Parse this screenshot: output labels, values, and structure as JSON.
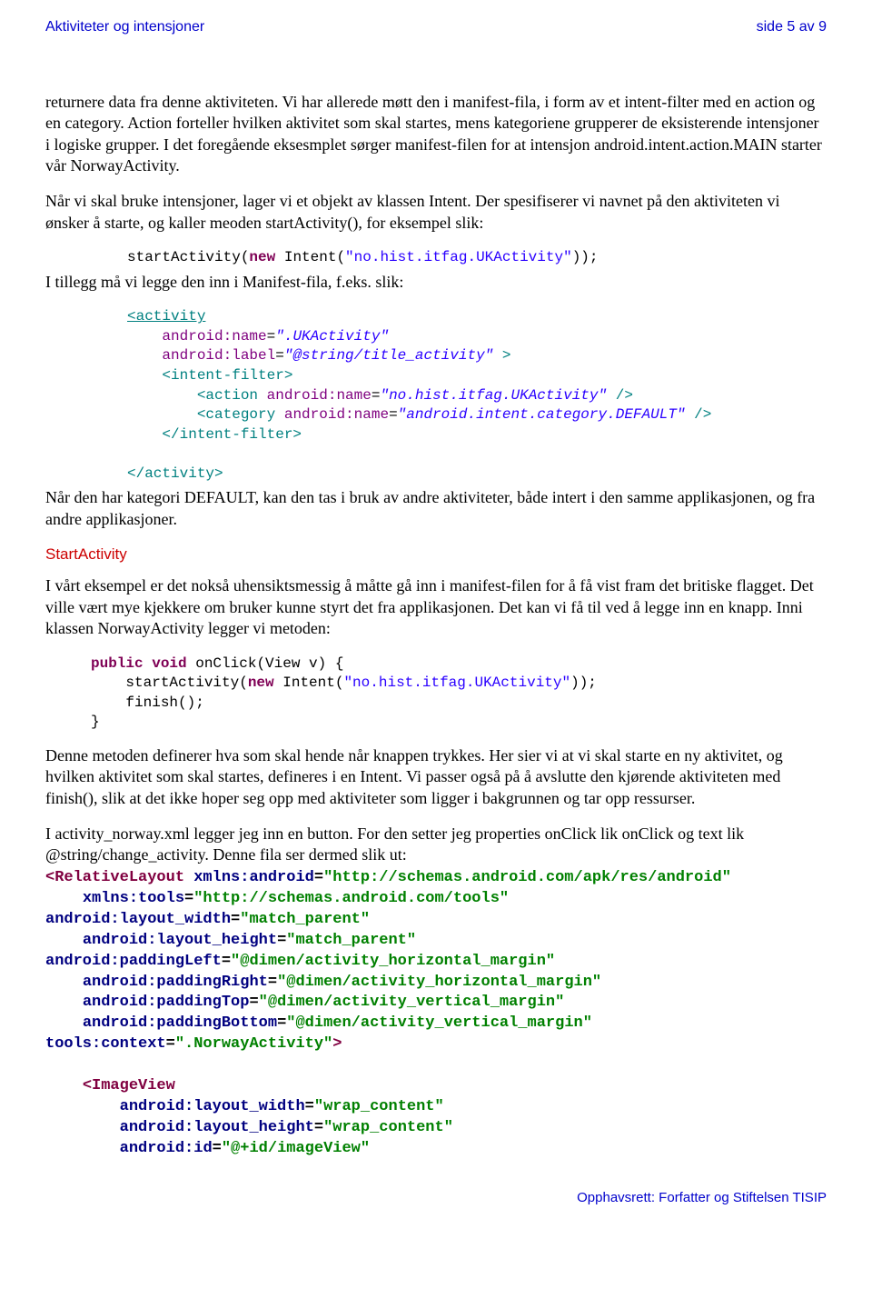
{
  "header": {
    "left": "Aktiviteter og intensjoner",
    "right": "side 5 av 9"
  },
  "para1": "returnere data fra denne aktiviteten. Vi har allerede møtt den i manifest-fila, i form av et intent-filter med en action og en category. Action forteller hvilken aktivitet som skal startes, mens kategoriene grupperer de eksisterende intensjoner i logiske grupper. I det foregående eksesmplet sørger manifest-filen for at intensjon android.intent.action.MAIN starter vår NorwayActivity.",
  "para2": "Når vi skal bruke intensjoner, lager vi et objekt av klassen Intent. Der spesifiserer vi navnet på den aktiviteten vi ønsker å starte, og kaller meoden startActivity(), for eksempel slik:",
  "code1_a": "startActivity(",
  "code1_b": "new",
  "code1_c": " Intent(",
  "code1_d": "\"no.hist.itfag.UKActivity\"",
  "code1_e": "));",
  "para3": "I tillegg må vi legge den inn i Manifest-fila, f.eks. slik:",
  "xml1": {
    "l1": "<activity",
    "l2": "android:name",
    "l2v": "\".UKActivity\"",
    "l3": "android:label",
    "l3v": "\"@string/title_activity\"",
    "l4": "<intent-filter>",
    "l5a": "<action",
    "l5b": "android:name",
    "l5c": "\"no.hist.itfag.UKActivity\"",
    "l6a": "<category",
    "l6b": "android:name",
    "l6c": "\"android.intent.category.DEFAULT\"",
    "l7": "</intent-filter>",
    "l8": "</activity>"
  },
  "para4": "Når den har kategori DEFAULT, kan den tas i bruk av andre aktiviteter, både intert i den samme applikasjonen, og fra andre applikasjoner.",
  "section": "StartActivity",
  "para5": "I vårt eksempel er det nokså uhensiktsmessig å måtte gå inn i manifest-filen for å få vist fram det britiske flagget. Det ville vært mye kjekkere om bruker kunne styrt det fra applikasjonen. Det kan vi få til ved å legge inn en knapp. Inni klassen NorwayActivity legger vi metoden:",
  "code2": {
    "l1a": "public",
    "l1b": " ",
    "l1c": "void",
    "l1d": " onClick(View v) {",
    "l2a": "startActivity(",
    "l2b": "new",
    "l2c": " Intent(",
    "l2d": "\"no.hist.itfag.UKActivity\"",
    "l2e": "));",
    "l3": "finish();",
    "l4": "}"
  },
  "para6": "Denne metoden definerer hva som skal hende når knappen trykkes. Her sier vi at vi skal starte en ny aktivitet, og hvilken aktivitet som skal startes, defineres i en Intent. Vi passer også på å avslutte den kjørende aktiviteten med finish(), slik at det ikke hoper seg opp med aktiviteter som ligger i bakgrunnen og tar opp ressurser.",
  "para7": "I activity_norway.xml legger jeg inn en button. For den setter jeg properties onClick lik onClick og text lik @string/change_activity. Denne fila ser dermed slik ut:",
  "xml2": {
    "l1a": "<",
    "l1b": "RelativeLayout",
    "l1c": "xmlns:android",
    "l1d": "\"http://schemas.android.com/apk/res/android\"",
    "l2a": "xmlns:tools",
    "l2b": "\"http://schemas.android.com/tools\"",
    "l3a": "android:layout_width",
    "l3b": "\"match_parent\"",
    "l4a": "android:layout_height",
    "l4b": "\"match_parent\"",
    "l5a": "android:paddingLeft",
    "l5b": "\"@dimen/activity_horizontal_margin\"",
    "l6a": "android:paddingRight",
    "l6b": "\"@dimen/activity_horizontal_margin\"",
    "l7a": "android:paddingTop",
    "l7b": "\"@dimen/activity_vertical_margin\"",
    "l8a": "android:paddingBottom",
    "l8b": "\"@dimen/activity_vertical_margin\"",
    "l9a": "tools:context",
    "l9b": "\".NorwayActivity\"",
    "l9c": ">",
    "l10a": "<",
    "l10b": "ImageView",
    "l11a": "android:layout_width",
    "l11b": "\"wrap_content\"",
    "l12a": "android:layout_height",
    "l12b": "\"wrap_content\"",
    "l13a": "android:id",
    "l13b": "\"@+id/imageView\""
  },
  "footer": "Opphavsrett:  Forfatter og Stiftelsen TISIP"
}
